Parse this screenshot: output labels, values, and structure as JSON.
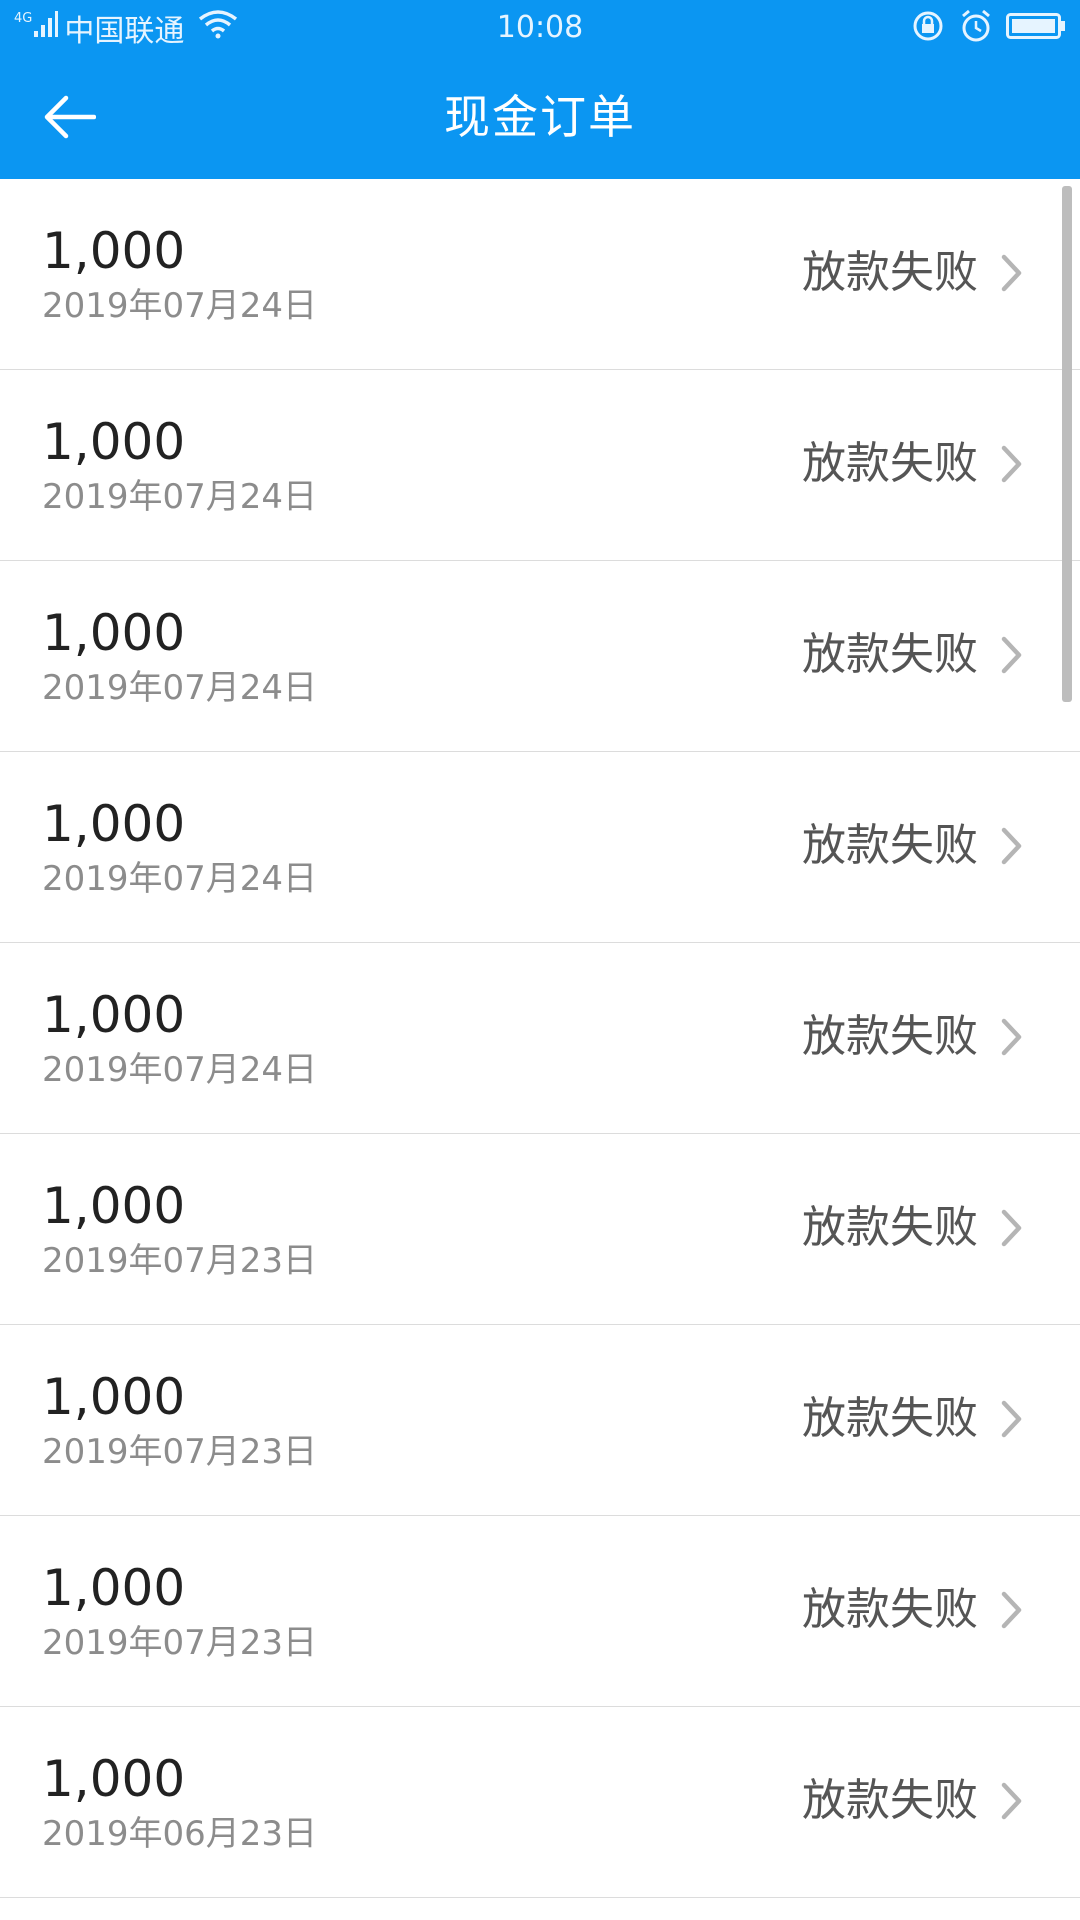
{
  "status_bar": {
    "network": "4G",
    "carrier": "中国联通",
    "time": "10:08",
    "icons": [
      "signal-icon",
      "wifi-icon",
      "lock-rotation-icon",
      "alarm-icon",
      "battery-icon"
    ]
  },
  "header": {
    "title": "现金订单",
    "back_icon": "back-arrow-icon",
    "background": "#0b96f2"
  },
  "orders": [
    {
      "amount": "1,000",
      "date": "2019年07月24日",
      "status": "放款失败"
    },
    {
      "amount": "1,000",
      "date": "2019年07月24日",
      "status": "放款失败"
    },
    {
      "amount": "1,000",
      "date": "2019年07月24日",
      "status": "放款失败"
    },
    {
      "amount": "1,000",
      "date": "2019年07月24日",
      "status": "放款失败"
    },
    {
      "amount": "1,000",
      "date": "2019年07月24日",
      "status": "放款失败"
    },
    {
      "amount": "1,000",
      "date": "2019年07月23日",
      "status": "放款失败"
    },
    {
      "amount": "1,000",
      "date": "2019年07月23日",
      "status": "放款失败"
    },
    {
      "amount": "1,000",
      "date": "2019年07月23日",
      "status": "放款失败"
    },
    {
      "amount": "1,000",
      "date": "2019年06月23日",
      "status": "放款失败"
    }
  ]
}
